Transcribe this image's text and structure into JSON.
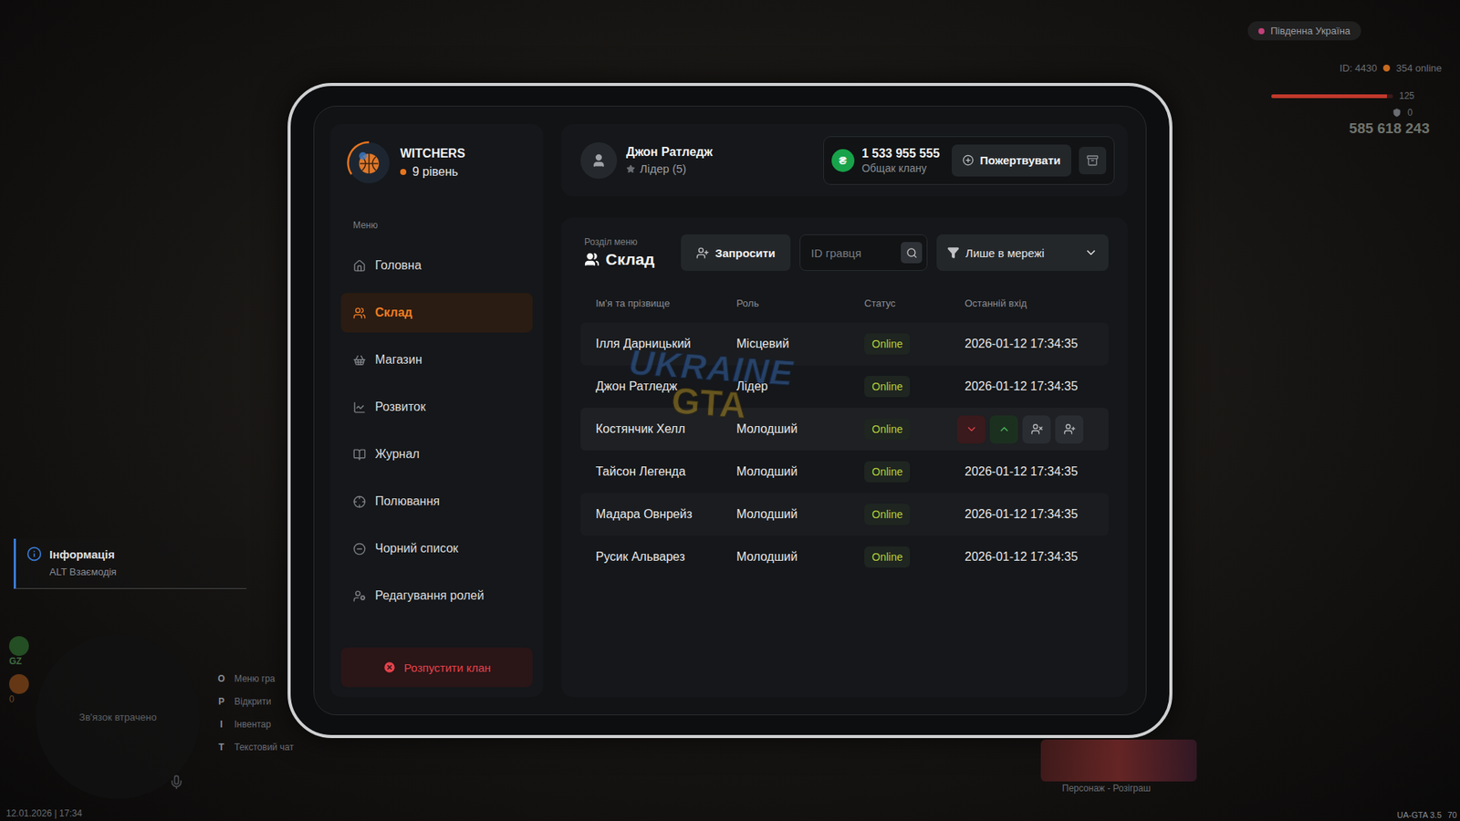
{
  "hud": {
    "region": "Південна Україна",
    "id": "ID: 4430",
    "online": "354 online",
    "health": {
      "value": "125",
      "level": 0.95
    },
    "armor": {
      "value": "0",
      "level": 0
    },
    "money": "585 618 243",
    "date": "12.01.2026 | 17:34",
    "version": "UA-GTA 3.5",
    "fps": "70",
    "gz": "GZ",
    "gz_count": "0",
    "info": {
      "title": "Інформація",
      "hint": "ALT Взаємодія"
    },
    "minimap": {
      "text": "Зв'язок втрачено"
    },
    "keybinds": [
      {
        "key": "O",
        "label": "Меню гра"
      },
      {
        "key": "P",
        "label": "Відкрити"
      },
      {
        "key": "I",
        "label": "Інвентар"
      },
      {
        "key": "T",
        "label": "Текстовий чат"
      }
    ],
    "giveaway": {
      "caption": "Персонаж - Розіграш"
    }
  },
  "watermark": {
    "line1": "UKRAINE",
    "line2": "GTA"
  },
  "clan": {
    "name": "WITCHERS",
    "level": "9 рівень"
  },
  "sidebar": {
    "label": "Меню",
    "items": [
      {
        "label": "Головна",
        "selected": false
      },
      {
        "label": "Склад",
        "selected": true
      },
      {
        "label": "Магазин",
        "selected": false
      },
      {
        "label": "Розвиток",
        "selected": false
      },
      {
        "label": "Журнал",
        "selected": false
      },
      {
        "label": "Полювання",
        "selected": false
      },
      {
        "label": "Чорний список",
        "selected": false
      },
      {
        "label": "Редагування ролей",
        "selected": false
      }
    ],
    "dissolve_button": "Розпустити клан"
  },
  "header": {
    "player": {
      "name": "Джон Ратледж",
      "rank": "Лідер (5)"
    },
    "treasury": {
      "currency": "₴",
      "amount": "1 533 955 555",
      "label": "Общак клану"
    },
    "donate_button": "Пожертвувати"
  },
  "section": {
    "caption": "Розділ меню",
    "title": "Склад"
  },
  "toolbar": {
    "invite_button": "Запросити",
    "search": {
      "placeholder": "ID гравця"
    },
    "filter": {
      "label": "Лише в мережі"
    }
  },
  "table": {
    "columns": [
      "Ім'я та прізвище",
      "Роль",
      "Статус",
      "Останній вхід"
    ],
    "rows": [
      {
        "name": "Ілля Дарницький",
        "role": "Місцевий",
        "status": "Online",
        "last_login": "2026-01-12 17:34:35",
        "hovered": false
      },
      {
        "name": "Джон Ратледж",
        "role": "Лідер",
        "status": "Online",
        "last_login": "2026-01-12 17:34:35",
        "hovered": false
      },
      {
        "name": "Костянчик Хелл",
        "role": "Молодший",
        "status": "Online",
        "last_login": "",
        "hovered": true
      },
      {
        "name": "Тайсон Легенда",
        "role": "Молодший",
        "status": "Online",
        "last_login": "2026-01-12 17:34:35",
        "hovered": false
      },
      {
        "name": "Мадара Овнрейз",
        "role": "Молодший",
        "status": "Online",
        "last_login": "2026-01-12 17:34:35",
        "hovered": false
      },
      {
        "name": "Русик Альварез",
        "role": "Молодший",
        "status": "Online",
        "last_login": "2026-01-12 17:34:35",
        "hovered": false
      }
    ]
  }
}
